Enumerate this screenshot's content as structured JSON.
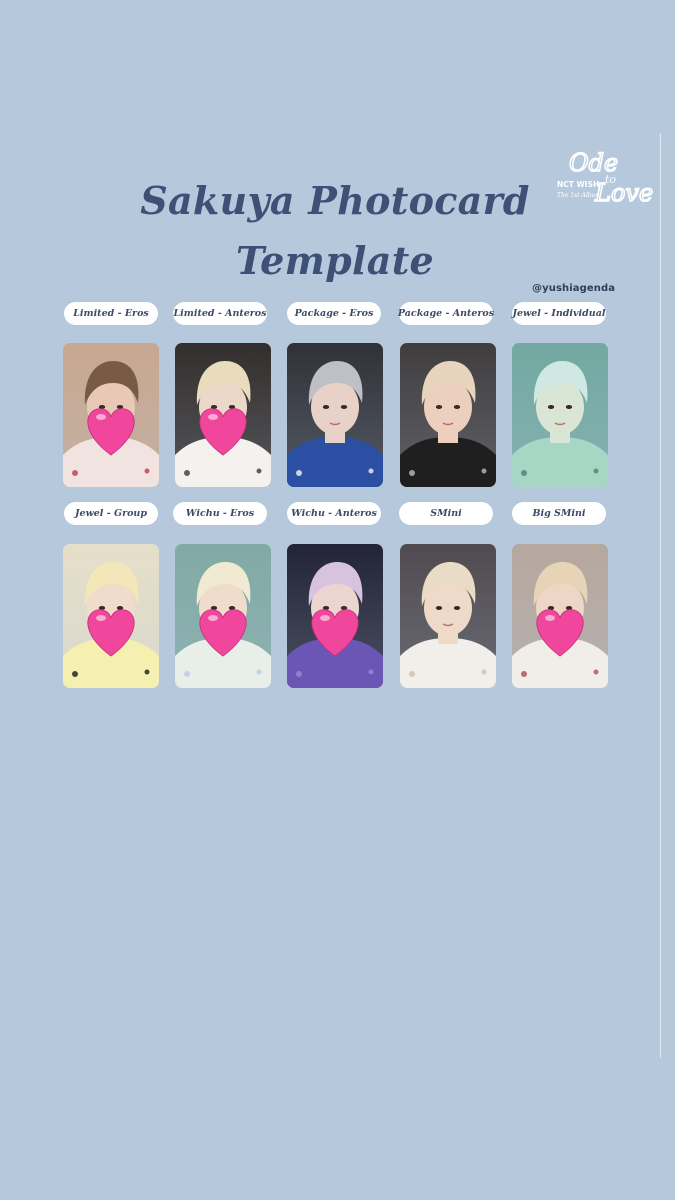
{
  "title": {
    "line1": "Sakuya Photocard",
    "line2": "Template"
  },
  "logo": {
    "top_text": "Ode",
    "mid_text": "to",
    "bottom_text": "Love",
    "group_text": "NCT WISH",
    "sub_text": "The 1st Album"
  },
  "handle": "@yushiagenda",
  "rows": [
    {
      "cards": [
        {
          "label": "Limited - Eros",
          "heart": true,
          "palette": "warm"
        },
        {
          "label": "Limited - Anteros",
          "heart": true,
          "palette": "cream"
        },
        {
          "label": "Package - Eros",
          "heart": false,
          "palette": "grey"
        },
        {
          "label": "Package - Anteros",
          "heart": false,
          "palette": "dark"
        },
        {
          "label": "Jewel - Individual",
          "heart": false,
          "palette": "teal"
        }
      ]
    },
    {
      "cards": [
        {
          "label": "Jewel - Group",
          "heart": true,
          "palette": "bright"
        },
        {
          "label": "Wichu - Eros",
          "heart": true,
          "palette": "mint"
        },
        {
          "label": "Wichu - Anteros",
          "heart": true,
          "palette": "purple"
        },
        {
          "label": "SMini",
          "heart": false,
          "palette": "beige"
        },
        {
          "label": "Big SMini",
          "heart": true,
          "palette": "soft"
        }
      ]
    }
  ],
  "colors": {
    "background": "#b6c8dc",
    "title": "#3d5076",
    "heart": "#f0479c"
  },
  "icons": [
    "heart-emoji-icon",
    "photo-portrait"
  ]
}
